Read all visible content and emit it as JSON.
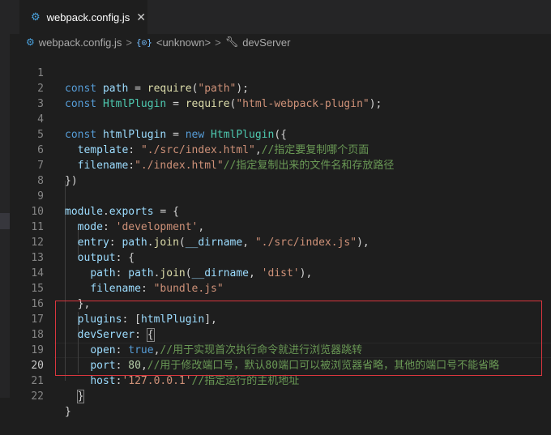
{
  "tab": {
    "filename": "webpack.config.js",
    "close_glyph": "✕",
    "icon": "js-icon",
    "icon_text": "JS"
  },
  "breadcrumb": {
    "file": "webpack.config.js",
    "scope": "<unknown>",
    "scope_icon_text": "{⊙}",
    "member": "devServer",
    "sep": ">"
  },
  "editor": {
    "active_line": 20,
    "lines": [
      {
        "n": "1"
      },
      {
        "n": "2"
      },
      {
        "n": "3"
      },
      {
        "n": "4"
      },
      {
        "n": "5"
      },
      {
        "n": "6"
      },
      {
        "n": "7"
      },
      {
        "n": "8"
      },
      {
        "n": "9"
      },
      {
        "n": "10"
      },
      {
        "n": "11"
      },
      {
        "n": "12"
      },
      {
        "n": "13"
      },
      {
        "n": "14"
      },
      {
        "n": "15"
      },
      {
        "n": "16"
      },
      {
        "n": "17"
      },
      {
        "n": "18"
      },
      {
        "n": "19"
      },
      {
        "n": "20"
      },
      {
        "n": "21"
      },
      {
        "n": "22"
      }
    ],
    "tokens": {
      "l1": [
        "const",
        " ",
        "path",
        " = ",
        "require",
        "(",
        "\"path\"",
        ");"
      ],
      "l2": [
        "const",
        " ",
        "HtmlPlugin",
        " = ",
        "require",
        "(",
        "\"html-webpack-plugin\"",
        ");"
      ],
      "l4": [
        "const",
        " ",
        "htmlPlugin",
        " = ",
        "new",
        " ",
        "HtmlPlugin",
        "({"
      ],
      "l5": [
        "  ",
        "template",
        ": ",
        "\"./src/index.html\"",
        ",",
        "//指定要复制哪个页面"
      ],
      "l6": [
        "  ",
        "filename",
        ":",
        "\"./index.html\"",
        "//指定复制出来的文件名和存放路径"
      ],
      "l7": [
        "})"
      ],
      "l9": [
        "module",
        ".",
        "exports",
        " = {"
      ],
      "l10": [
        "  ",
        "mode",
        ": ",
        "'development'",
        ","
      ],
      "l11": [
        "  ",
        "entry",
        ": ",
        "path",
        ".",
        "join",
        "(",
        "__dirname",
        ", ",
        "\"./src/index.js\"",
        "),"
      ],
      "l12": [
        "  ",
        "output",
        ": {"
      ],
      "l13": [
        "    ",
        "path",
        ": ",
        "path",
        ".",
        "join",
        "(",
        "__dirname",
        ", ",
        "'dist'",
        "),"
      ],
      "l14": [
        "    ",
        "filename",
        ": ",
        "\"bundle.js\""
      ],
      "l15": [
        "  },"
      ],
      "l16": [
        "  ",
        "plugins",
        ": [",
        "htmlPlugin",
        "],"
      ],
      "l17": [
        "  ",
        "devServer",
        ": ",
        "{"
      ],
      "l18": [
        "    ",
        "open",
        ": ",
        "true",
        ",",
        "//用于实现首次执行命令就进行浏览器跳转"
      ],
      "l19": [
        "    ",
        "port",
        ": ",
        "80",
        ",",
        "//用于修改端口号，默认80端口可以被浏览器省略，其他的端口号不能省略"
      ],
      "l20": [
        "    ",
        "host",
        ":",
        "'127.0.0.1'",
        "//指定运行的主机地址"
      ],
      "l21": [
        "  ",
        "}"
      ],
      "l22": [
        "}"
      ]
    }
  },
  "colors": {
    "keyword": "#569cd6",
    "variable": "#9cdcfe",
    "class": "#4ec9b0",
    "function": "#dcdcaa",
    "string": "#ce9178",
    "number": "#b5cea8",
    "comment": "#6a9955",
    "highlight_box": "#d9363e"
  }
}
